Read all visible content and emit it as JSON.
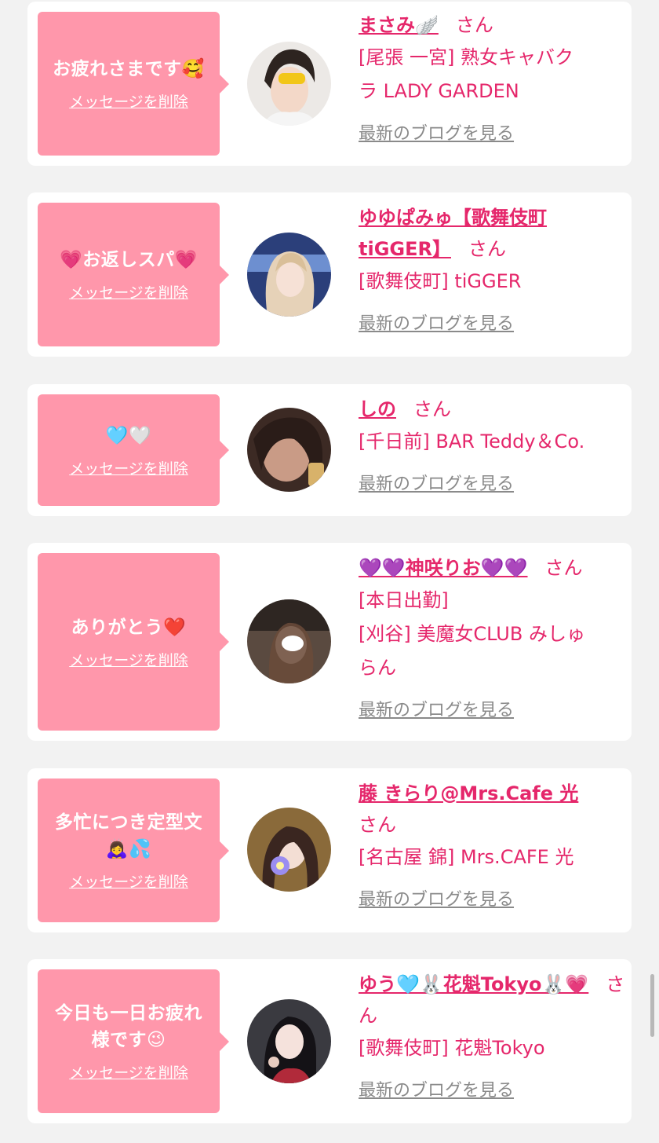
{
  "colors": {
    "bubble_bg": "#ff97ab",
    "accent_pink": "#e5276b",
    "link_gray": "#8a8a8a",
    "page_bg": "#f2f2f2"
  },
  "cards": [
    {
      "message_lines": [
        "お疲れさまです🥰"
      ],
      "delete_label": "メッセージを削除",
      "name": "まさみ🪽",
      "san": "さん",
      "shop_lines": [
        "[尾張 一宮] 熟女キャバク",
        "ラ LADY GARDEN"
      ],
      "blog_label": "最新のブログを見る"
    },
    {
      "message_lines": [
        "💗お返しスパ💗"
      ],
      "delete_label": "メッセージを削除",
      "name": "ゆゆぱみゅ【歌舞伎町 tiGGER】",
      "san": "さん",
      "shop_lines": [
        "[歌舞伎町] tiGGER"
      ],
      "blog_label": "最新のブログを見る"
    },
    {
      "message_lines": [
        "🩵🤍"
      ],
      "delete_label": "メッセージを削除",
      "name": "しの",
      "san": "さん",
      "shop_lines": [
        "[千日前] BAR Teddy＆Co."
      ],
      "blog_label": "最新のブログを見る"
    },
    {
      "message_lines": [
        "ありがとう❤️"
      ],
      "delete_label": "メッセージを削除",
      "name": "💜💜神咲りお💜💜",
      "san": "さん",
      "shop_lines": [
        "[本日出勤]",
        "[刈谷] 美魔女CLUB みしゅ",
        "らん"
      ],
      "blog_label": "最新のブログを見る"
    },
    {
      "message_lines": [
        "多忙につき定型文",
        "🙇‍♀️💦"
      ],
      "delete_label": "メッセージを削除",
      "name": "藤 きらり@Mrs.Cafe 光",
      "san": "さん",
      "shop_lines": [
        "[名古屋 錦] Mrs.CAFE 光"
      ],
      "blog_label": "最新のブログを見る"
    },
    {
      "message_lines": [
        "今日も一日お疲れ",
        "様です😉"
      ],
      "delete_label": "メッセージを削除",
      "name": "ゆう🩵🐰花魁Tokyo🐰💗",
      "san": "さん",
      "shop_lines": [
        "[歌舞伎町] 花魁Tokyo"
      ],
      "blog_label": "最新のブログを見る"
    }
  ]
}
